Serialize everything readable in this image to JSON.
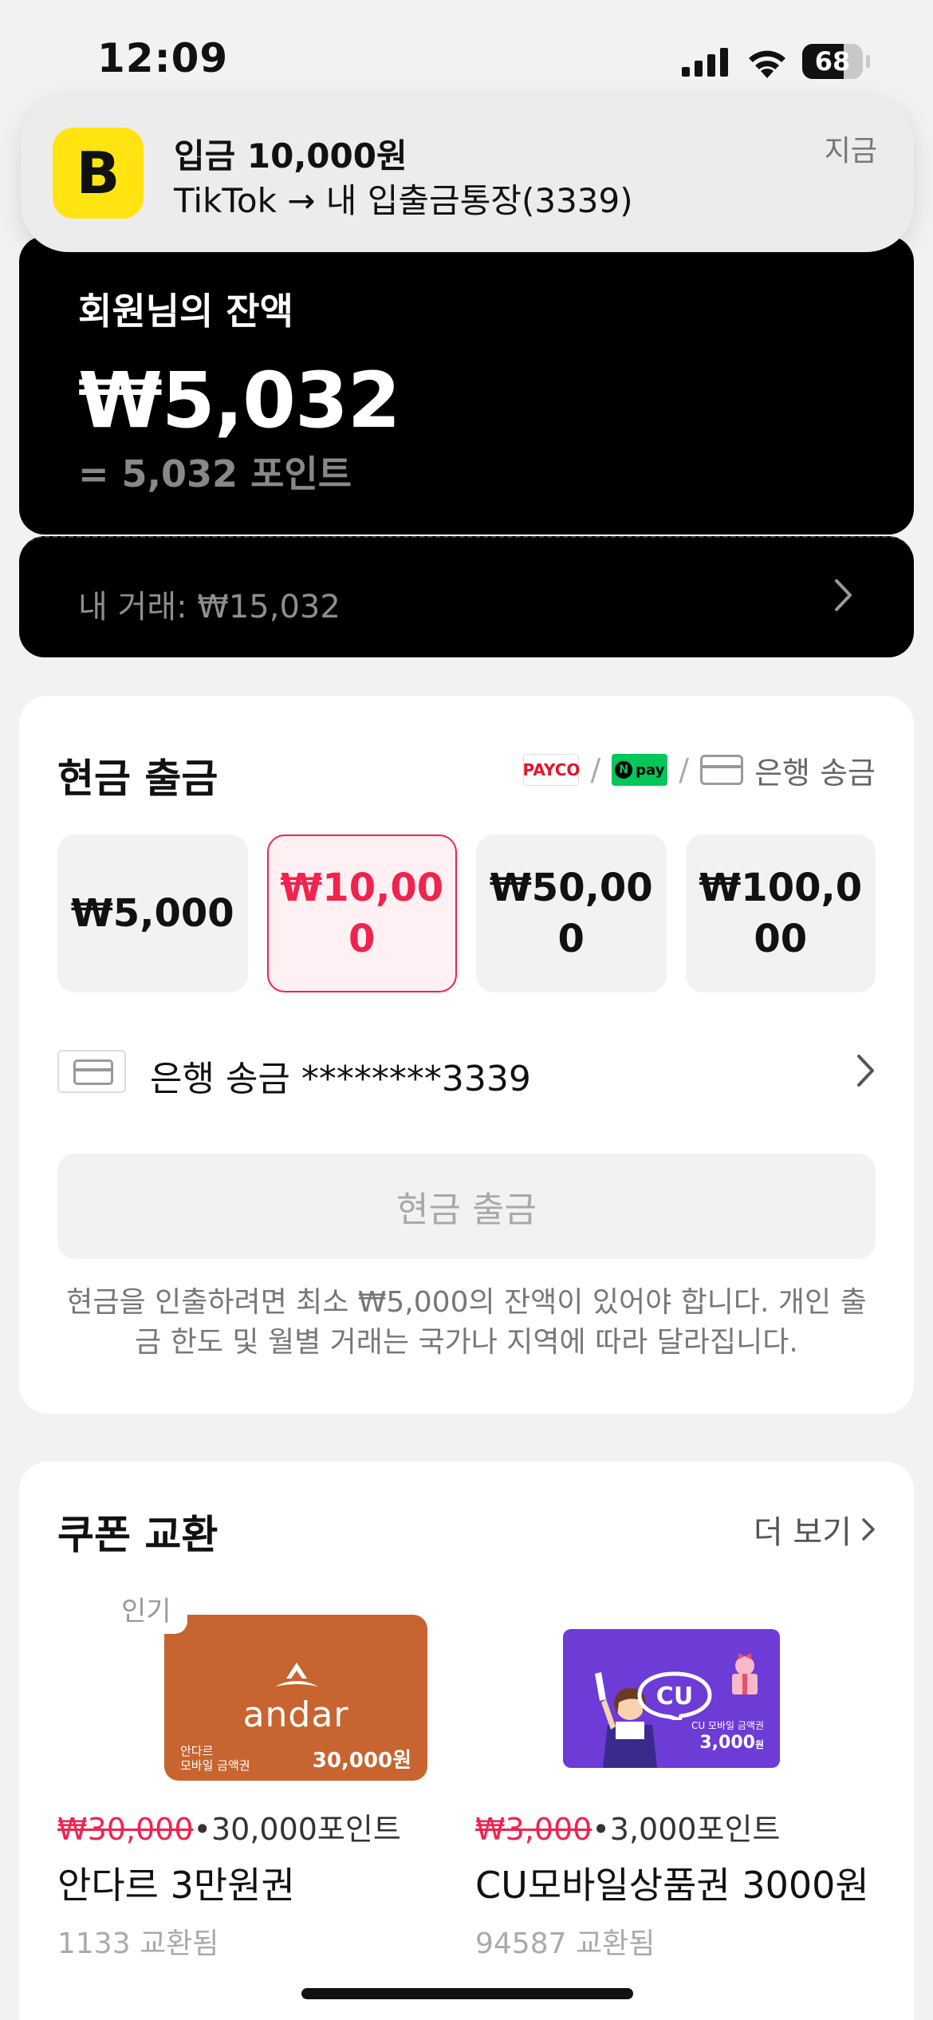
{
  "status_bar": {
    "time": "12:09",
    "battery": "68",
    "battery_level": 0.68
  },
  "notification": {
    "app_icon_letter": "B",
    "title": "입금 10,000원",
    "body": "TikTok → 내 입출금통장(3339)",
    "time": "지금",
    "accent": "#ffe411"
  },
  "balance": {
    "label": "회원님의 잔액",
    "amount": "₩5,032",
    "points": "= 5,032 포인트",
    "trade_summary": "내 거래: ₩15,032"
  },
  "withdraw": {
    "title": "현금 출금",
    "methods": {
      "payco": "PAYCO",
      "npay": "pay",
      "npay_badge": "N",
      "separator": "/",
      "bank": "은행 송금"
    },
    "amounts": [
      "₩5,000",
      "₩10,000",
      "₩50,000",
      "₩100,000"
    ],
    "selected_index": 1,
    "bank_account": "은행 송금 ********3339",
    "button_label": "현금 출금",
    "notice": "현금을 인출하려면 최소 ₩5,000의 잔액이 있어야 합니다. 개인 출금 한도 및 월별 거래는 국가나 지역에 따라 달라집니다.",
    "accent": "#f0234f"
  },
  "coupons": {
    "title": "쿠폰 교환",
    "more_label": "더 보기",
    "items": [
      {
        "tag": "인기",
        "brand": "andar",
        "card_caption_1": "안다르",
        "card_caption_2": "모바일 금액권",
        "card_price": "30,000원",
        "original_price": "₩30,000",
        "point_price": "•30,000포인트",
        "name": "안다르 3만원권",
        "exchanged": "1133 교환됨"
      },
      {
        "brand": "CU",
        "card_caption": "CU 모바일 금액권",
        "card_price": "3,000",
        "card_price_unit": "원",
        "original_price": "₩3,000",
        "point_price": "•3,000포인트",
        "name": "CU모바일상품권 3000원",
        "exchanged": "94587 교환됨"
      }
    ]
  }
}
